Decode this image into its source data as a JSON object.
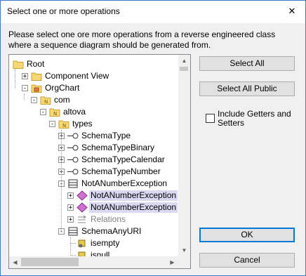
{
  "window": {
    "title": "Select one or more operations",
    "close_glyph": "✕"
  },
  "description": "Please select one ore more operations from a reverse engineered class where a sequence diagram should be generated from.",
  "tree": {
    "items": [
      {
        "label": "Root",
        "icon": "folder-icon",
        "level": 0,
        "expander": "",
        "selected": false,
        "muted": false
      },
      {
        "label": "Component View",
        "icon": "folder-icon",
        "level": 1,
        "expander": "+",
        "selected": false,
        "muted": false
      },
      {
        "label": "OrgChart",
        "icon": "package-folder-icon",
        "level": 1,
        "expander": "-",
        "selected": false,
        "muted": false
      },
      {
        "label": "com",
        "icon": "namespace-folder-icon",
        "level": 2,
        "expander": "-",
        "selected": false,
        "muted": false
      },
      {
        "label": "altova",
        "icon": "namespace-folder-icon",
        "level": 3,
        "expander": "-",
        "selected": false,
        "muted": false
      },
      {
        "label": "types",
        "icon": "namespace-folder-icon",
        "level": 4,
        "expander": "-",
        "selected": false,
        "muted": false
      },
      {
        "label": "SchemaType",
        "icon": "interface-icon",
        "level": 5,
        "expander": "+",
        "selected": false,
        "muted": false
      },
      {
        "label": "SchemaTypeBinary",
        "icon": "interface-icon",
        "level": 5,
        "expander": "+",
        "selected": false,
        "muted": false
      },
      {
        "label": "SchemaTypeCalendar",
        "icon": "interface-icon",
        "level": 5,
        "expander": "+",
        "selected": false,
        "muted": false
      },
      {
        "label": "SchemaTypeNumber",
        "icon": "interface-icon",
        "level": 5,
        "expander": "+",
        "selected": false,
        "muted": false
      },
      {
        "label": "NotANumberException",
        "icon": "class-icon",
        "level": 5,
        "expander": "-",
        "selected": false,
        "muted": false
      },
      {
        "label": "NotANumberException",
        "icon": "operation-icon",
        "level": 6,
        "expander": "+",
        "selected": true,
        "muted": false
      },
      {
        "label": "NotANumberException",
        "icon": "operation-icon",
        "level": 6,
        "expander": "+",
        "selected": true,
        "muted": false
      },
      {
        "label": "Relations",
        "icon": "relations-icon",
        "level": 6,
        "expander": "+",
        "selected": false,
        "muted": true
      },
      {
        "label": "SchemaAnyURI",
        "icon": "class-icon",
        "level": 5,
        "expander": "-",
        "selected": false,
        "muted": false
      },
      {
        "label": "isempty",
        "icon": "method-icon",
        "level": 6,
        "expander": "",
        "selected": false,
        "muted": false
      },
      {
        "label": "isnull",
        "icon": "method-icon",
        "level": 6,
        "expander": "",
        "selected": false,
        "muted": false
      }
    ]
  },
  "buttons": {
    "select_all": "Select All",
    "select_all_public": "Select All Public",
    "ok": "OK",
    "cancel": "Cancel"
  },
  "options": {
    "include_getters_setters": "Include Getters and Setters",
    "include_getters_setters_checked": false
  },
  "colors": {
    "selection": "#d9d9f3",
    "accent": "#0078d7",
    "folder": "#f8d775",
    "operation": "#d070d0"
  }
}
